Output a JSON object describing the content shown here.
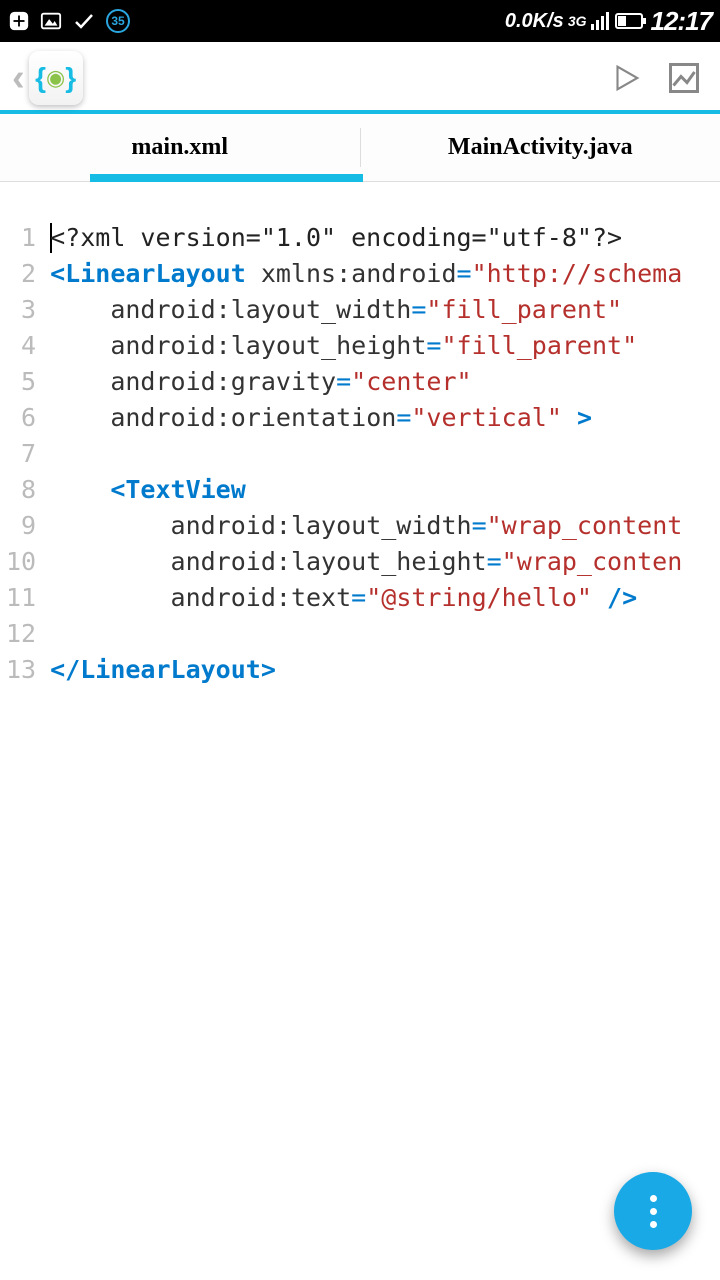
{
  "status": {
    "speed": "0.0K/s",
    "net": "3G",
    "time": "12:17",
    "badge": "35"
  },
  "tabs": {
    "t0": "main.xml",
    "t1": "MainActivity.java"
  },
  "lines": {
    "l1": "1",
    "l2": "2",
    "l3": "3",
    "l4": "4",
    "l5": "5",
    "l6": "6",
    "l7": "7",
    "l8": "8",
    "l9": "9",
    "l10": "10",
    "l11": "11",
    "l12": "12",
    "l13": "13"
  },
  "code": {
    "decl": "<?xml version=\"1.0\" encoding=\"utf-8\"?>",
    "ll_open": "<LinearLayout",
    "xmlns_attr": " xmlns:android",
    "xmlns_val": "\"http://schema",
    "lw_attr": "android:layout_width",
    "lw_val": "\"fill_parent\"",
    "lh_attr": "android:layout_height",
    "lh_val": "\"fill_parent\"",
    "gr_attr": "android:gravity",
    "gr_val": "\"center\"",
    "or_attr": "android:orientation",
    "or_val": "\"vertical\"",
    "gt": " >",
    "tv_open": "<TextView",
    "tv_lw_attr": "android:layout_width",
    "tv_lw_val": "\"wrap_content",
    "tv_lh_attr": "android:layout_height",
    "tv_lh_val": "\"wrap_conten",
    "tv_tx_attr": "android:text",
    "tv_tx_val": "\"@string/hello\"",
    "selfclose": " />",
    "ll_close": "</LinearLayout>",
    "eq": "="
  }
}
